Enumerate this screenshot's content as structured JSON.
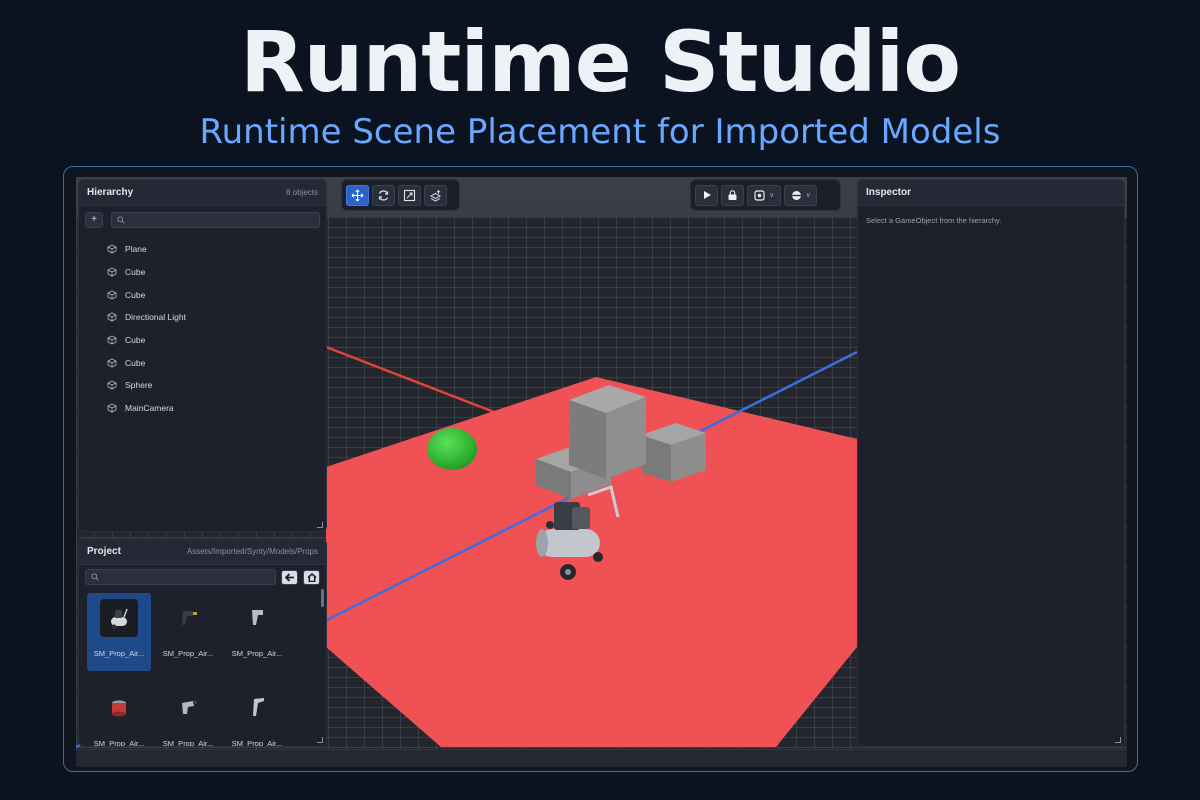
{
  "hero": {
    "title": "Runtime Studio",
    "subtitle": "Runtime Scene Placement for Imported Models"
  },
  "colors": {
    "accent": "#2a62c9",
    "plane": "#f05154",
    "sphere": "#2fbf2f",
    "x_axis": "#e0443c",
    "z_axis": "#3d6ee0"
  },
  "hierarchy": {
    "title": "Hierarchy",
    "count": "8 objects",
    "add_label": "+",
    "search_placeholder": "",
    "items": [
      {
        "label": "Plane",
        "icon": "cube-icon"
      },
      {
        "label": "Cube",
        "icon": "cube-icon"
      },
      {
        "label": "Cube",
        "icon": "cube-icon"
      },
      {
        "label": "Directional Light",
        "icon": "cube-icon"
      },
      {
        "label": "Cube",
        "icon": "cube-icon"
      },
      {
        "label": "Cube",
        "icon": "cube-icon"
      },
      {
        "label": "Sphere",
        "icon": "cube-icon"
      },
      {
        "label": "MainCamera",
        "icon": "cube-icon"
      }
    ]
  },
  "project": {
    "title": "Project",
    "path": "Assets/Imported/Synty/Models/Props",
    "search_placeholder": "",
    "assets": [
      {
        "label": "SM_Prop_Air...",
        "selected": true,
        "icon": "air-compressor-icon"
      },
      {
        "label": "SM_Prop_Air...",
        "selected": false,
        "icon": "air-drill-icon"
      },
      {
        "label": "SM_Prop_Air...",
        "selected": false,
        "icon": "air-gun-icon"
      },
      {
        "label": "SM_Prop_Air...",
        "selected": false,
        "icon": "air-filter-icon"
      },
      {
        "label": "SM_Prop_Air...",
        "selected": false,
        "icon": "air-tool-icon"
      },
      {
        "label": "SM_Prop_Air...",
        "selected": false,
        "icon": "air-blower-icon"
      }
    ]
  },
  "toolbar": {
    "transform_tools": [
      "move-tool-icon",
      "rotate-tool-icon",
      "scale-tool-icon",
      "snap-tool-icon"
    ],
    "active_tool": "move-tool-icon",
    "play_controls": [
      "play-icon",
      "lock-icon",
      "camera-mode-icon",
      "shading-mode-icon"
    ],
    "dropdown_chevron": "v"
  },
  "inspector": {
    "title": "Inspector",
    "hint": "Select a GameObject from the hierarchy."
  }
}
